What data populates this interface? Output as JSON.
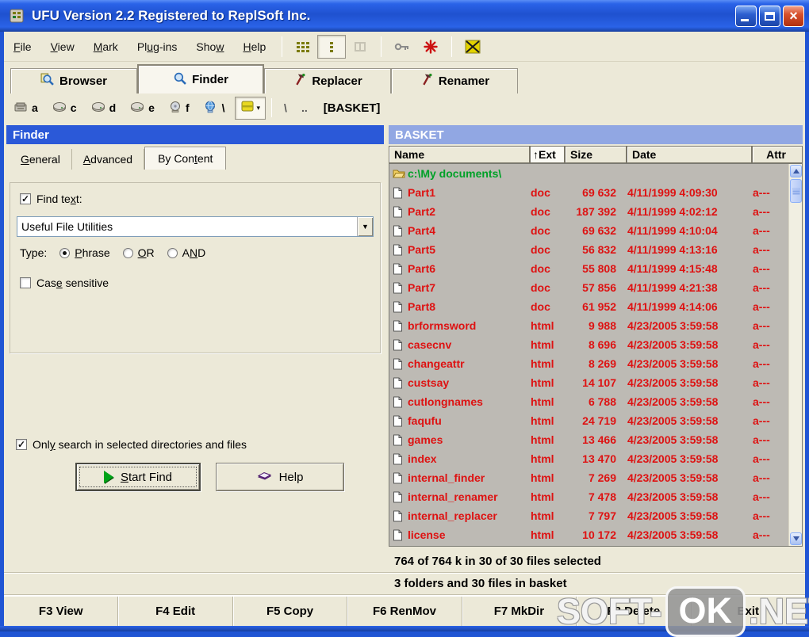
{
  "window": {
    "title": "UFU Version 2.2 Registered to ReplSoft Inc."
  },
  "menu": {
    "items": [
      "File",
      "View",
      "Mark",
      "Plug-ins",
      "Show",
      "Help"
    ]
  },
  "toolbar": {
    "icons": [
      "multi-pane-icon",
      "single-pane-icon",
      "dual-pane-disabled-icon",
      "key-icon",
      "red-asterisk-icon",
      "clear-basket-icon"
    ]
  },
  "main_tabs": {
    "items": [
      "Browser",
      "Finder",
      "Replacer",
      "Renamer"
    ],
    "active": "Finder"
  },
  "drive_bar": {
    "drives": [
      "a",
      "c",
      "d",
      "e",
      "f",
      "\\"
    ],
    "path_buttons": [
      "\\",
      ".."
    ],
    "path_label": "[BASKET]"
  },
  "finder_panel": {
    "header": "Finder",
    "tabs": [
      "General",
      "Advanced",
      "By Content"
    ],
    "active_tab": "By Content",
    "find_text_label": "Find text:",
    "find_text_checked": "✓",
    "search_value": "Useful File Utilities",
    "type_label": "Type:",
    "type_options": [
      "Phrase",
      "OR",
      "AND"
    ],
    "type_selected": "Phrase",
    "case_sensitive_label": "Case sensitive",
    "only_search_label": "Only search in selected directories and files",
    "only_search_checked": "✓",
    "start_find_label": "Start Find",
    "help_label": "Help"
  },
  "basket_panel": {
    "header": "BASKET",
    "columns": {
      "name": "Name",
      "ext": "↑Ext",
      "size": "Size",
      "date": "Date",
      "attr": "Attr"
    },
    "folder_path": "c:\\My documents\\",
    "files": [
      {
        "name": "Part1",
        "ext": "doc",
        "size": "69 632",
        "date": "4/11/1999 4:09:30",
        "attr": "a---"
      },
      {
        "name": "Part2",
        "ext": "doc",
        "size": "187 392",
        "date": "4/11/1999 4:02:12",
        "attr": "a---"
      },
      {
        "name": "Part4",
        "ext": "doc",
        "size": "69 632",
        "date": "4/11/1999 4:10:04",
        "attr": "a---"
      },
      {
        "name": "Part5",
        "ext": "doc",
        "size": "56 832",
        "date": "4/11/1999 4:13:16",
        "attr": "a---"
      },
      {
        "name": "Part6",
        "ext": "doc",
        "size": "55 808",
        "date": "4/11/1999 4:15:48",
        "attr": "a---"
      },
      {
        "name": "Part7",
        "ext": "doc",
        "size": "57 856",
        "date": "4/11/1999 4:21:38",
        "attr": "a---"
      },
      {
        "name": "Part8",
        "ext": "doc",
        "size": "61 952",
        "date": "4/11/1999 4:14:06",
        "attr": "a---"
      },
      {
        "name": "brformsword",
        "ext": "html",
        "size": "9 988",
        "date": "4/23/2005 3:59:58",
        "attr": "a---"
      },
      {
        "name": "casecnv",
        "ext": "html",
        "size": "8 696",
        "date": "4/23/2005 3:59:58",
        "attr": "a---"
      },
      {
        "name": "changeattr",
        "ext": "html",
        "size": "8 269",
        "date": "4/23/2005 3:59:58",
        "attr": "a---"
      },
      {
        "name": "custsay",
        "ext": "html",
        "size": "14 107",
        "date": "4/23/2005 3:59:58",
        "attr": "a---"
      },
      {
        "name": "cutlongnames",
        "ext": "html",
        "size": "6 788",
        "date": "4/23/2005 3:59:58",
        "attr": "a---"
      },
      {
        "name": "faqufu",
        "ext": "html",
        "size": "24 719",
        "date": "4/23/2005 3:59:58",
        "attr": "a---"
      },
      {
        "name": "games",
        "ext": "html",
        "size": "13 466",
        "date": "4/23/2005 3:59:58",
        "attr": "a---"
      },
      {
        "name": "index",
        "ext": "html",
        "size": "13 470",
        "date": "4/23/2005 3:59:58",
        "attr": "a---"
      },
      {
        "name": "internal_finder",
        "ext": "html",
        "size": "7 269",
        "date": "4/23/2005 3:59:58",
        "attr": "a---"
      },
      {
        "name": "internal_renamer",
        "ext": "html",
        "size": "7 478",
        "date": "4/23/2005 3:59:58",
        "attr": "a---"
      },
      {
        "name": "internal_replacer",
        "ext": "html",
        "size": "7 797",
        "date": "4/23/2005 3:59:58",
        "attr": "a---"
      },
      {
        "name": "license",
        "ext": "html",
        "size": "10 172",
        "date": "4/23/2005 3:59:58",
        "attr": "a---"
      }
    ],
    "status_selected": "764 of 764 k in 30 of 30 files selected",
    "status_basket": "3 folders and 30 files in basket"
  },
  "function_bar": {
    "items": [
      "F3 View",
      "F4 Edit",
      "F5 Copy",
      "F6 RenMov",
      "F7 MkDir",
      "F8 Delete",
      "Exit"
    ]
  },
  "watermark": {
    "left": "SOFT-",
    "badge": "OK",
    "right": ".NET"
  },
  "colors": {
    "title_blue": "#2a63e8",
    "finder_header": "#2b59d8",
    "basket_header": "#91a7e3",
    "selected_text": "#de1212",
    "folder_text": "#00a128",
    "chrome": "#ece9d8",
    "list_bg": "#bdbab4"
  }
}
